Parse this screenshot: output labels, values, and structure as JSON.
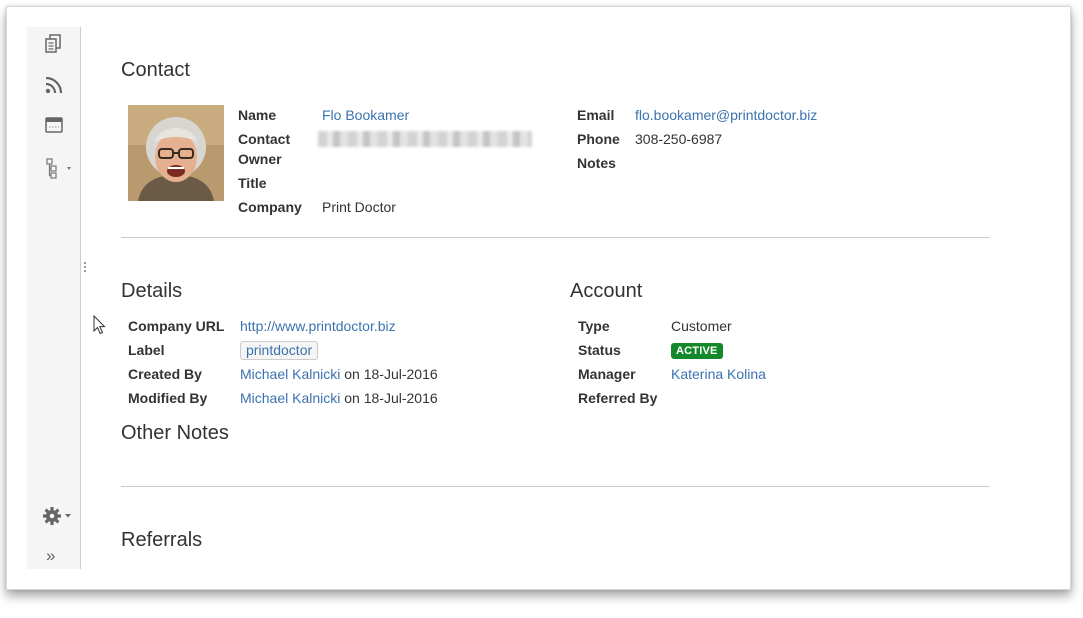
{
  "sidebar": {
    "icons": [
      "pages-icon",
      "rss-feed-icon",
      "calendar-icon",
      "page-tree-icon"
    ],
    "settings_icon": "gear-icon",
    "expand_icon": "expand-sidebar-icon",
    "expand_glyph": "»"
  },
  "contact": {
    "title": "Contact",
    "fields": {
      "name_label": "Name",
      "name_value": "Flo Bookamer",
      "owner_label_1": "Contact",
      "owner_label_2": "Owner",
      "title_label": "Title",
      "company_label": "Company",
      "company_value": "Print Doctor",
      "email_label": "Email",
      "email_value": "flo.bookamer@printdoctor.biz",
      "phone_label": "Phone",
      "phone_value": "308-250-6987",
      "notes_label": "Notes"
    }
  },
  "details": {
    "title": "Details",
    "company_url_label": "Company URL",
    "company_url_value": "http://www.printdoctor.biz",
    "label_label": "Label",
    "label_tag": "printdoctor",
    "created_by_label": "Created By",
    "created_by_user": "Michael Kalnicki",
    "created_on": "on 18-Jul-2016",
    "modified_by_label": "Modified By",
    "modified_by_user": "Michael Kalnicki",
    "modified_on": "on 18-Jul-2016"
  },
  "account": {
    "title": "Account",
    "type_label": "Type",
    "type_value": "Customer",
    "status_label": "Status",
    "status_value": "ACTIVE",
    "status_color": "#14892c",
    "manager_label": "Manager",
    "manager_value": "Katerina Kolina",
    "referred_by_label": "Referred By"
  },
  "other_notes": {
    "title": "Other Notes"
  },
  "referrals": {
    "title": "Referrals"
  },
  "colors": {
    "link": "#3b73af",
    "sidebar_bg": "#f5f5f5",
    "divider": "#cccccc"
  }
}
